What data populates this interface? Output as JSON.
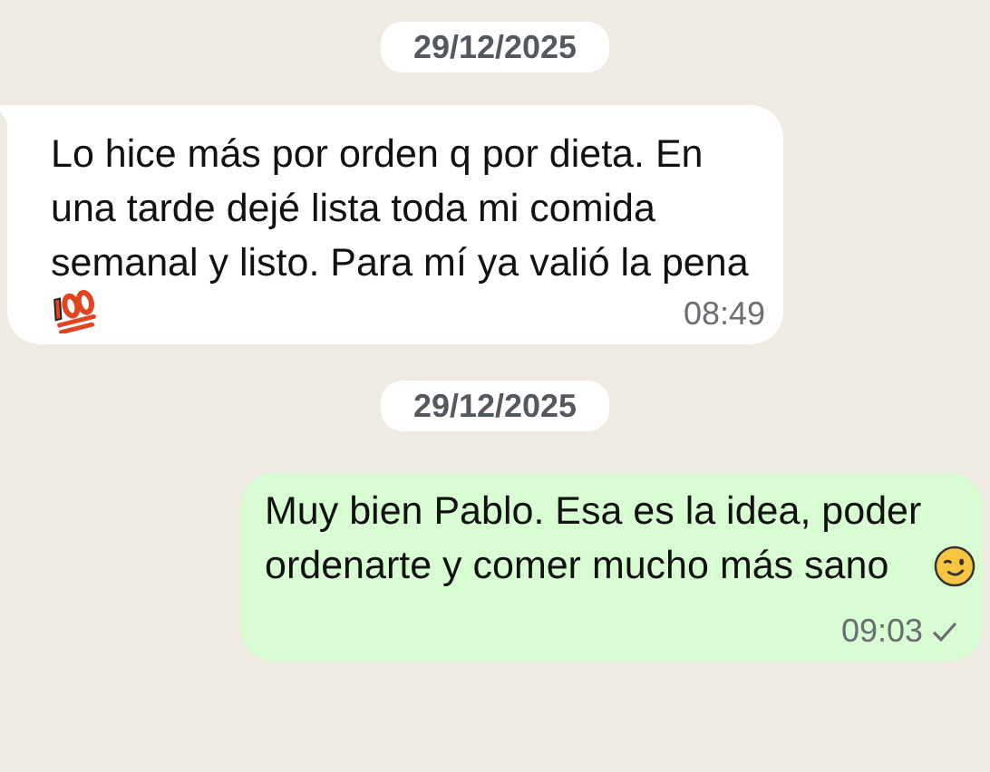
{
  "messages": [
    {
      "kind": "date",
      "text": "29/12/2025"
    },
    {
      "kind": "incoming",
      "text": "Lo hice más por orden q por dieta. En una tarde dejé lista toda mi comida semanal y listo. Para mí ya valió la pena",
      "time": "08:49"
    },
    {
      "kind": "date",
      "text": "29/12/2025"
    },
    {
      "kind": "outgoing",
      "text": "Muy bien Pablo. Esa es la idea, poder ordenarte y comer mucho más sano",
      "time": "09:03",
      "read": false
    }
  ]
}
